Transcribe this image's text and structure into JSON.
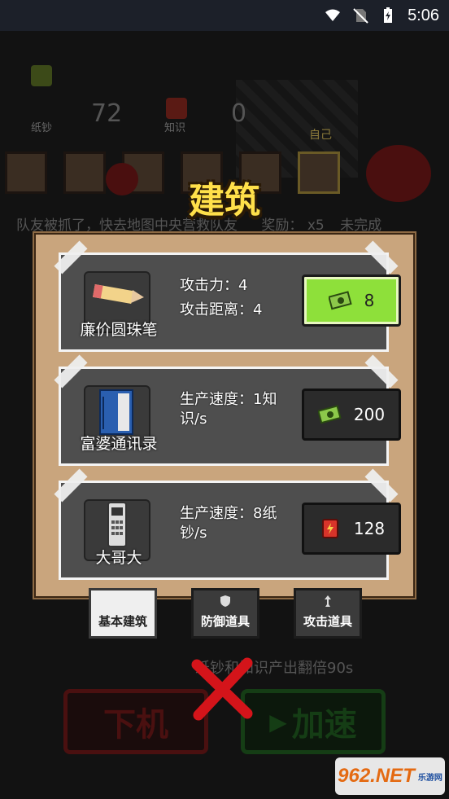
{
  "status": {
    "time": "5:06"
  },
  "background": {
    "cash_label": "纸钞",
    "cash_value": "72",
    "knowledge_label": "知识",
    "knowledge_value": "0",
    "self_label": "自己",
    "mission_text": "队友被抓了，快去地图中央营救队友",
    "reward_text": "奖励：",
    "reward_mult": "x5",
    "reward_status": "未完成",
    "boost_text": "纸钞和知识产出翻倍90s",
    "logout_btn": "下机",
    "speed_btn": "加速"
  },
  "modal": {
    "title": "建筑",
    "items": [
      {
        "name": "廉价圆珠笔",
        "stat1": "攻击力：4",
        "stat2": "攻击距离：4",
        "price": "8",
        "currency": "cash",
        "active": true
      },
      {
        "name": "富婆通讯录",
        "stat1": "生产速度：1知",
        "stat2": "识/s",
        "price": "200",
        "currency": "cash",
        "active": false
      },
      {
        "name": "大哥大",
        "stat1": "生产速度：8纸",
        "stat2": "钞/s",
        "price": "128",
        "currency": "book",
        "active": false
      }
    ],
    "tabs": [
      {
        "label": "基本建筑",
        "selected": true
      },
      {
        "label": "防御道具",
        "selected": false
      },
      {
        "label": "攻击道具",
        "selected": false
      }
    ]
  },
  "watermark": {
    "number": "962.NET",
    "sub": "乐游网"
  },
  "colors": {
    "title": "#ffe04a",
    "active_price": "#8ee03a",
    "panel": "#c9a57d",
    "card": "#4e4e4e"
  }
}
